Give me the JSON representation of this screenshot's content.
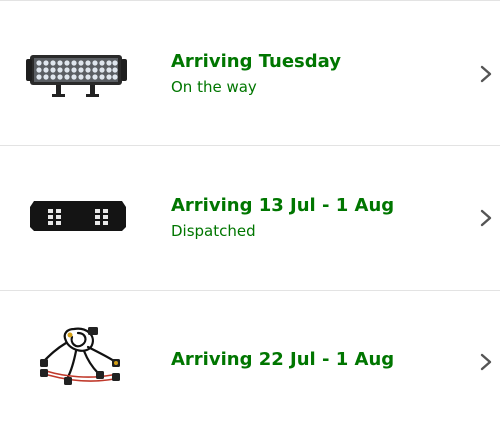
{
  "colors": {
    "arrival_green": "#007600",
    "chevron": "#555555",
    "divider": "#e3e3e3"
  },
  "orders": [
    {
      "arrival": "Arriving Tuesday",
      "status": "On the way",
      "image": "led-light-bar-image"
    },
    {
      "arrival": "Arriving 13 Jul - 1 Aug",
      "status": "Dispatched",
      "image": "licence-plate-bracket-image"
    },
    {
      "arrival": "Arriving 22 Jul - 1 Aug",
      "status": "",
      "image": "wiring-harness-image"
    }
  ]
}
